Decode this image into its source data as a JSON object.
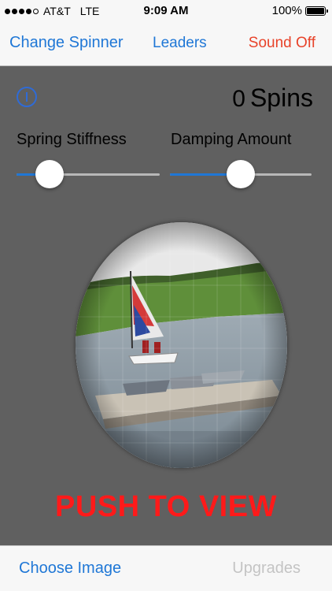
{
  "status_bar": {
    "carrier": "AT&T",
    "network": "LTE",
    "time": "9:09 AM",
    "battery": "100%",
    "signal_bars_filled": 4,
    "signal_bars_total": 5
  },
  "navbar": {
    "left_button": "Change Spinner",
    "middle_button": "Leaders",
    "right_button": "Sound Off",
    "accent_color": "#1f77d6",
    "right_color": "#e8432a"
  },
  "spins": {
    "count": "0",
    "label": "Spins"
  },
  "sliders": {
    "stiffness": {
      "label": "Spring Stiffness",
      "value": 0.23
    },
    "damping": {
      "label": "Damping Amount",
      "value": 0.5
    }
  },
  "spinner": {
    "image_subject": "sailboat-lake-photo"
  },
  "push_label": "PUSH TO VIEW",
  "bottom_bar": {
    "choose_image": "Choose Image",
    "upgrades": "Upgrades"
  },
  "icons": {
    "info": "info-icon",
    "battery": "battery-icon",
    "signal": "signal-icon"
  }
}
